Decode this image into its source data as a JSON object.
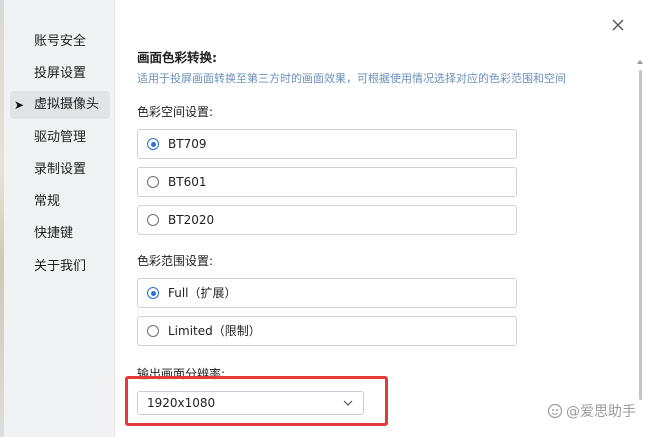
{
  "sidebar": {
    "items": [
      {
        "label": "账号安全"
      },
      {
        "label": "投屏设置"
      },
      {
        "label": "虚拟摄像头",
        "active": true
      },
      {
        "label": "驱动管理"
      },
      {
        "label": "录制设置"
      },
      {
        "label": "常规"
      },
      {
        "label": "快捷键"
      },
      {
        "label": "关于我们"
      }
    ]
  },
  "main": {
    "section_title": "画面色彩转换:",
    "description": "适用于投屏画面转换至第三方时的画面效果，可根据使用情况选择对应的色彩范围和空间",
    "color_space": {
      "label": "色彩空间设置:",
      "options": [
        "BT709",
        "BT601",
        "BT2020"
      ],
      "selected": "BT709"
    },
    "color_range": {
      "label": "色彩范围设置:",
      "options": [
        "Full（扩展）",
        "Limited（限制）"
      ],
      "selected": "Full（扩展）"
    },
    "resolution": {
      "label": "输出画面分辨率:",
      "value": "1920x1080"
    }
  },
  "watermark": {
    "text": "@爱思助手"
  },
  "colors": {
    "accent": "#2a6ed8",
    "highlight": "#e53a3a",
    "description": "#6b8fb8"
  }
}
